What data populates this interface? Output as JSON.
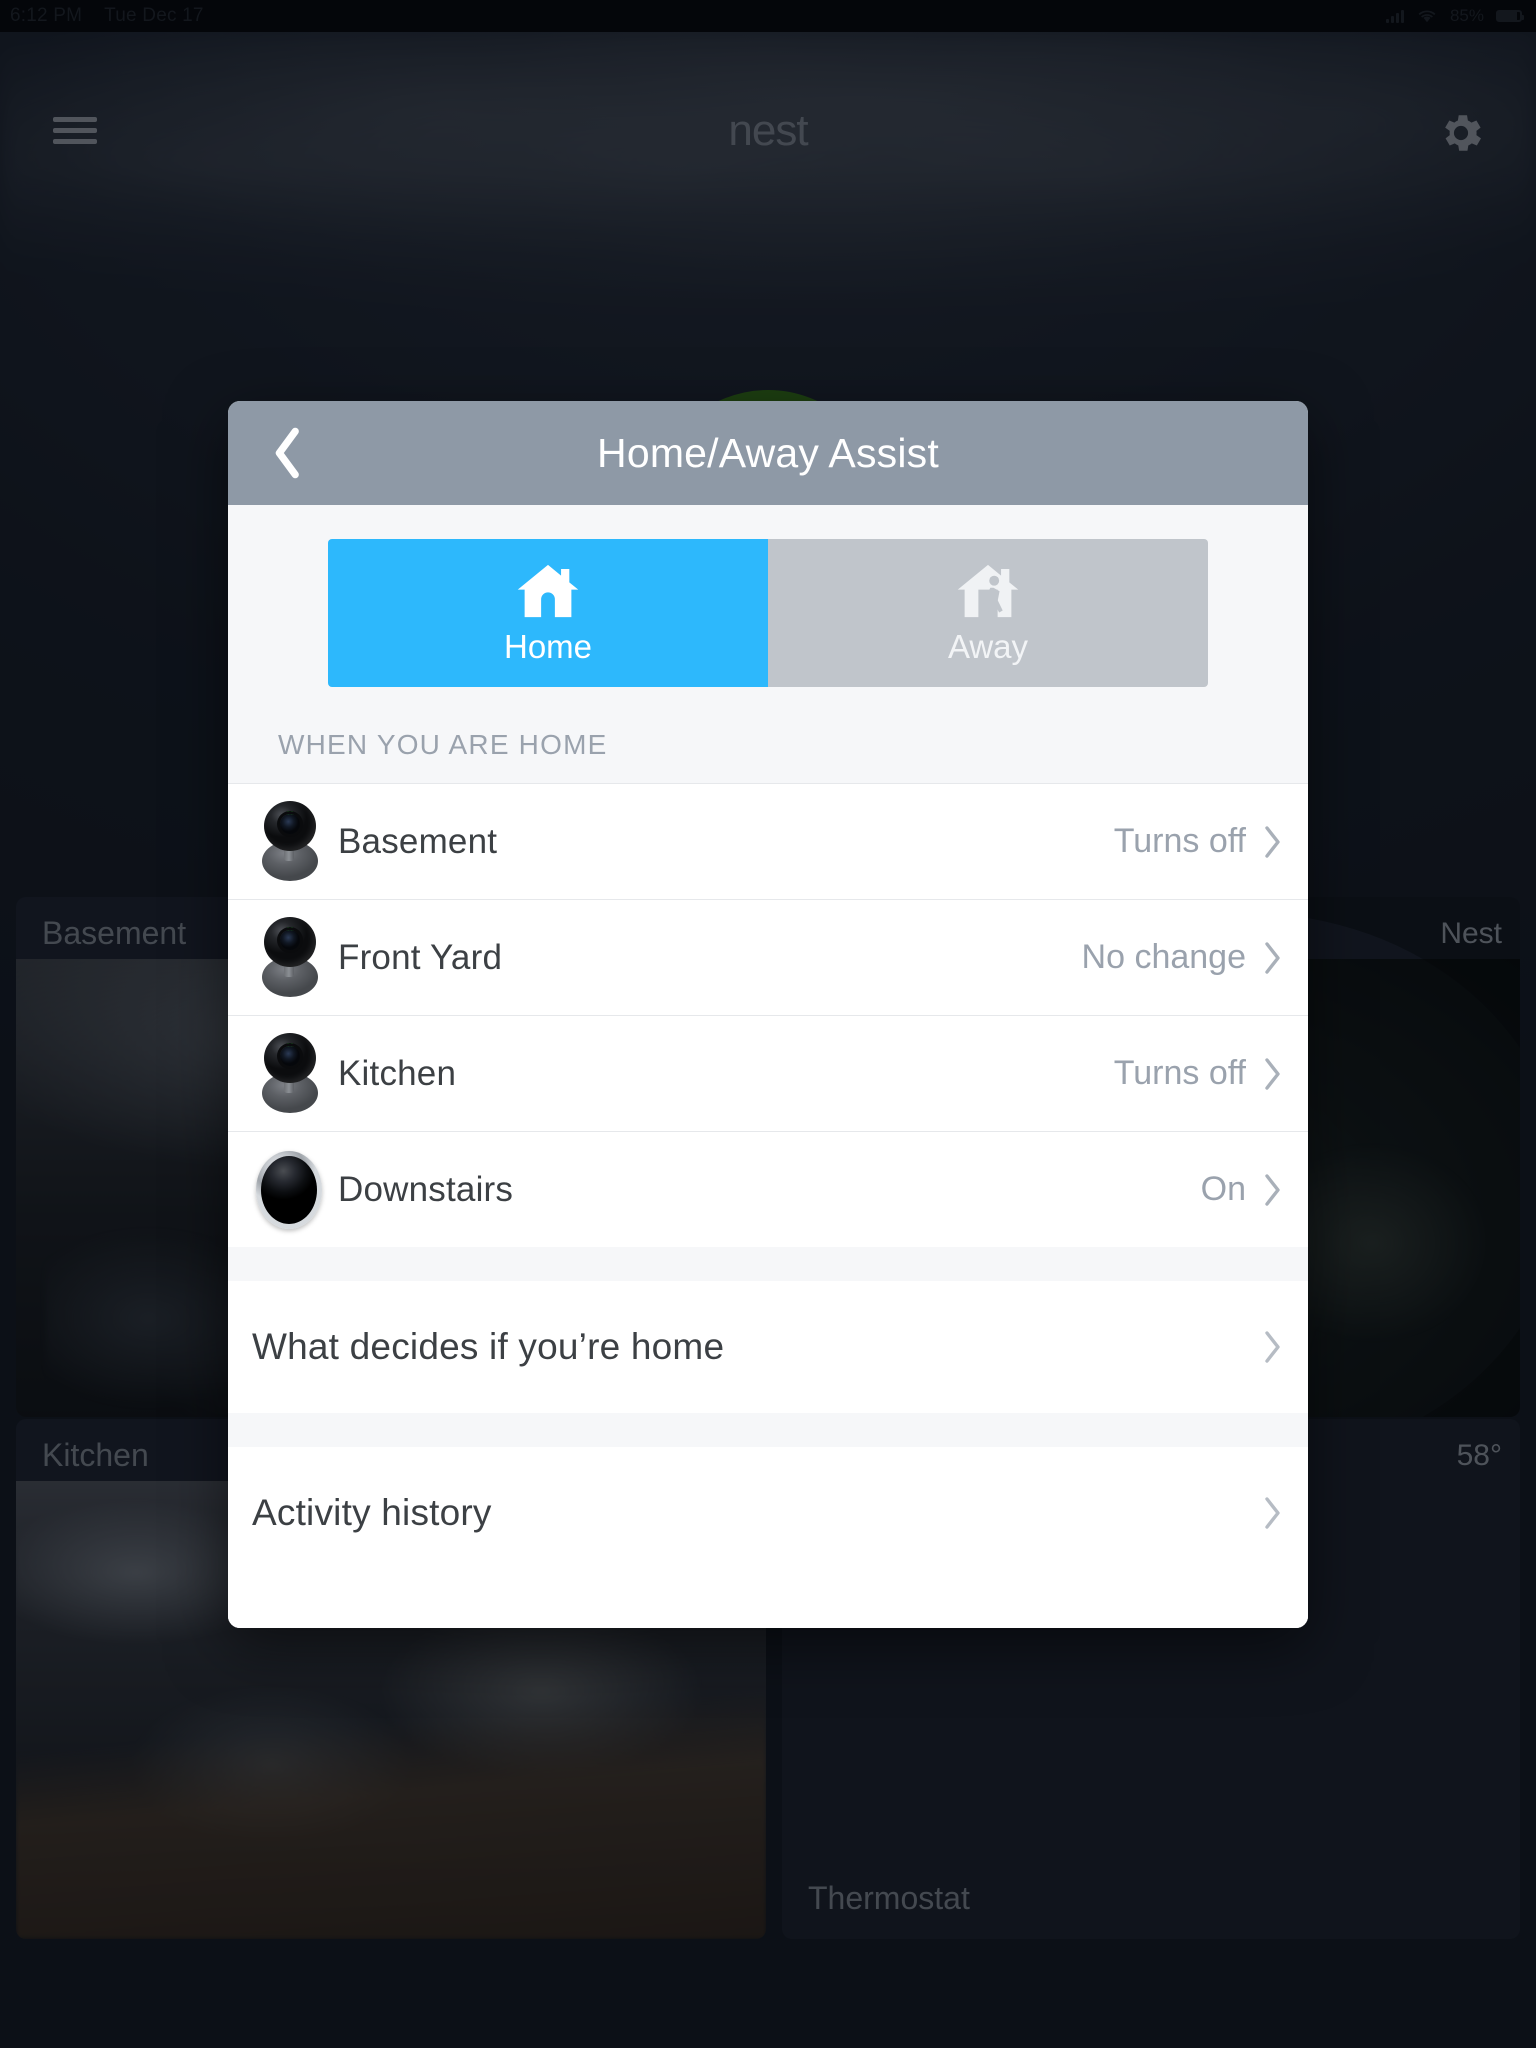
{
  "status_bar": {
    "time": "6:12 PM",
    "date": "Tue Dec 17",
    "battery_percent": "85%",
    "signal_icon": "cellular-signal-icon",
    "wifi_icon": "wifi-icon",
    "battery_icon": "battery-icon"
  },
  "app_header": {
    "menu_icon": "hamburger-menu-icon",
    "logo": "nest",
    "settings_icon": "gear-icon"
  },
  "background": {
    "cards": [
      {
        "label": "Basement",
        "corner": ""
      },
      {
        "label": "",
        "corner": "Nest"
      },
      {
        "label": "Kitchen",
        "corner": ""
      },
      {
        "label": "Thermostat",
        "corner": "58°"
      }
    ]
  },
  "modal": {
    "title": "Home/Away Assist",
    "back_icon": "chevron-left-icon",
    "segments": [
      {
        "label": "Home",
        "icon": "house-icon",
        "selected": true
      },
      {
        "label": "Away",
        "icon": "house-person-walking-icon",
        "selected": false
      }
    ],
    "section_header": "WHEN YOU ARE HOME",
    "devices": [
      {
        "name": "Basement",
        "value": "Turns off",
        "icon": "nest-cam-icon",
        "chevron": "chevron-right-icon"
      },
      {
        "name": "Front Yard",
        "value": "No change",
        "icon": "nest-cam-icon",
        "chevron": "chevron-right-icon"
      },
      {
        "name": "Kitchen",
        "value": "Turns off",
        "icon": "nest-cam-icon",
        "chevron": "chevron-right-icon"
      },
      {
        "name": "Downstairs",
        "value": "On",
        "icon": "nest-thermostat-icon",
        "chevron": "chevron-right-icon"
      }
    ],
    "menu_items": [
      {
        "label": "What decides if you’re home",
        "chevron": "chevron-right-icon"
      },
      {
        "label": "Activity history",
        "chevron": "chevron-right-icon"
      }
    ]
  },
  "colors": {
    "accent_blue": "#2db8fc",
    "segment_inactive": "#c0c5cb",
    "header_gray": "#8e99a6",
    "ring_green": "#3f8a16",
    "value_gray": "#9aa2ad"
  }
}
